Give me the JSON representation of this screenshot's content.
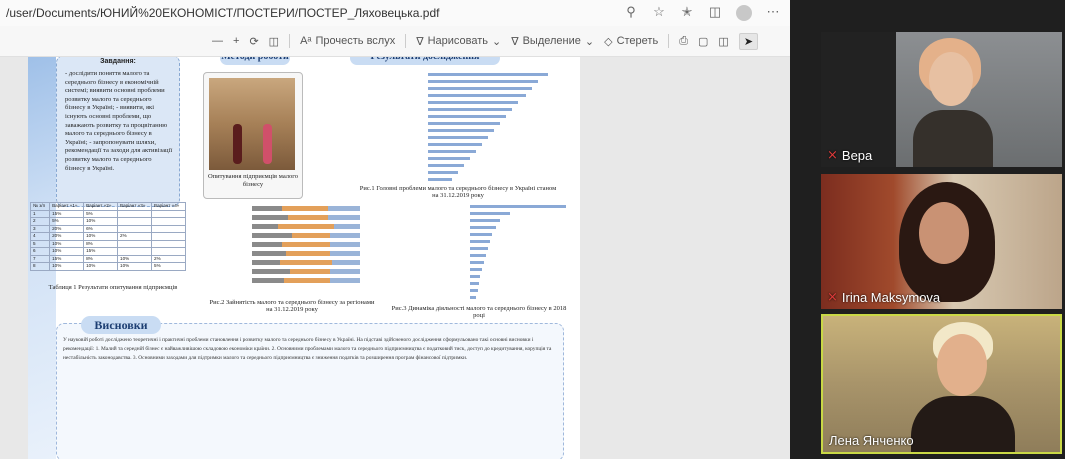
{
  "browser": {
    "url": "/user/Documents/ЮНИЙ%20ЕКОНОМІСТ/ПОСТЕРИ/ПОСТЕР_Ляховецька.pdf",
    "icons": [
      "zoom-icon",
      "star-icon",
      "favorites-icon",
      "collections-icon",
      "profile-avatar",
      "more-icon"
    ]
  },
  "pdf_toolbar": {
    "minus": "—",
    "plus": "+",
    "read_aloud": "Прочесть вслух",
    "draw": "Нарисовать",
    "highlight": "Выделение",
    "erase": "Стереть"
  },
  "poster": {
    "goals_title": "Завдання:",
    "goals_text": "- дослідити поняття малого та середнього бізнесу в економічній системі; виявити основні проблеми розвитку малого та середнього бізнесу в Україні; - виявити, які існують основні проблеми, що заважають розвитку та процвітанню малого та середнього бізнесу в Україні; - запропонувати шляхи, рекомендації та заходи для активізації розвитку малого та середнього бізнесу в Україні.",
    "section_method": "Методи роботи",
    "section_results": "Результати дослідження",
    "photo_caption": "Опитування підприємців малого бізнесу",
    "fig1_caption": "Рис.1 Головні проблеми малого та середнього бізнесу в Україні станом на 31.12.2019 року",
    "fig2_caption": "Рис.2 Зайнятість малого та середнього бізнесу за регіонами на 31.12.2019 року",
    "fig3_caption": "Рис.3 Динаміка діяльності малого та середнього бізнесу в 2018 році",
    "table_caption": "Таблиця 1 Результати опитування підприємців",
    "conclusions_title": "Висновки",
    "conclusions_text": "У науковій роботі досліджено теоретичні і практичні проблеми становлення і розвитку малого та середнього бізнесу в Україні. На підставі здійсненого дослідження сформульовано такі основні висновки і рекомендації: 1. Малий та середній бізнес є найважливішою складовою економіки країни. 2. Основними проблемами малого та середнього підприємництва є податковий тиск, доступ до кредитування, корупція та нестабільність законодавства. 3. Основними заходами для підтримки малого та середнього підприємництва є зниження податків та розширення програм фінансової підтримки."
  },
  "table": {
    "headers": [
      "№ з/п",
      "Варіант «1»",
      "Варіант «2»",
      "Варіант «3»",
      "Варіант «4»"
    ],
    "rows": [
      [
        "1",
        "15%",
        "5%",
        "",
        ""
      ],
      [
        "2",
        "5%",
        "10%",
        "",
        ""
      ],
      [
        "3",
        "20%",
        "6%",
        "",
        ""
      ],
      [
        "4",
        "20%",
        "10%",
        "2%",
        ""
      ],
      [
        "5",
        "10%",
        "8%",
        "",
        ""
      ],
      [
        "6",
        "10%",
        "15%",
        "",
        ""
      ],
      [
        "7",
        "15%",
        "8%",
        "10%",
        "2%"
      ],
      [
        "8",
        "10%",
        "10%",
        "10%",
        "5%"
      ]
    ]
  },
  "participants": [
    {
      "name": "Вера",
      "muted": true
    },
    {
      "name": "Irina Maksymova",
      "muted": true
    },
    {
      "name": "Лена Янченко",
      "muted": false
    }
  ]
}
